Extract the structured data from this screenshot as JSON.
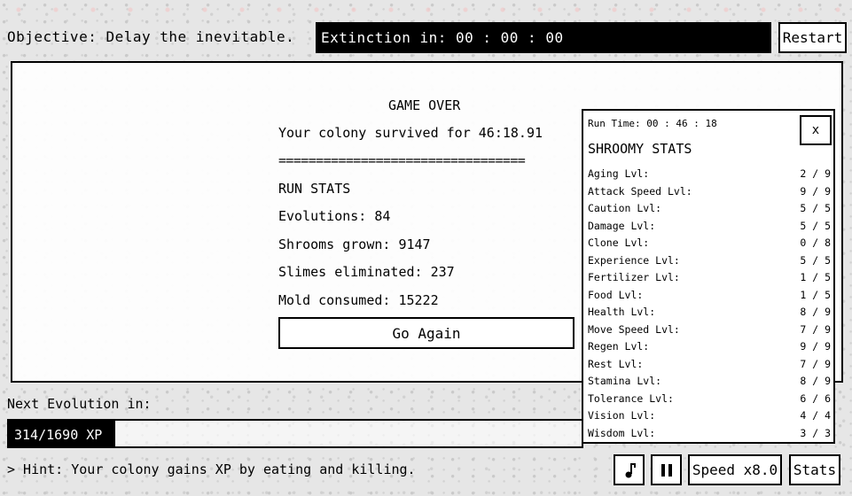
{
  "header": {
    "objective": "Objective: Delay the inevitable.",
    "extinction": "Extinction in: 00 : 00 : 00",
    "restart_label": "Restart"
  },
  "game_over": {
    "title": "GAME OVER",
    "survived": "Your colony survived for 46:18.91",
    "divider": "=================================",
    "run_stats_heading": "RUN STATS",
    "evolutions": "Evolutions: 84",
    "shrooms": "Shrooms grown: 9147",
    "slimes": "Slimes eliminated: 237",
    "mold": "Mold consumed: 15222",
    "go_again_label": "Go Again"
  },
  "stats_panel": {
    "run_time": "Run Time: 00 : 46 : 18",
    "title": "SHROOMY STATS",
    "close_label": "x",
    "rows": [
      {
        "label": "Aging Lvl:",
        "value": "2 / 9"
      },
      {
        "label": "Attack Speed Lvl:",
        "value": "9 / 9"
      },
      {
        "label": "Caution Lvl:",
        "value": "5 / 5"
      },
      {
        "label": "Damage Lvl:",
        "value": "5 / 5"
      },
      {
        "label": "Clone Lvl:",
        "value": "0 / 8"
      },
      {
        "label": "Experience Lvl:",
        "value": "5 / 5"
      },
      {
        "label": "Fertilizer Lvl:",
        "value": "1 / 5"
      },
      {
        "label": "Food Lvl:",
        "value": "1 / 5"
      },
      {
        "label": "Health Lvl:",
        "value": "8 / 9"
      },
      {
        "label": "Move Speed Lvl:",
        "value": "7 / 9"
      },
      {
        "label": "Regen Lvl:",
        "value": "9 / 9"
      },
      {
        "label": "Rest Lvl:",
        "value": "7 / 9"
      },
      {
        "label": "Stamina Lvl:",
        "value": "8 / 9"
      },
      {
        "label": "Tolerance Lvl:",
        "value": "6 / 6"
      },
      {
        "label": "Vision Lvl:",
        "value": "4 / 4"
      },
      {
        "label": "Wisdom Lvl:",
        "value": "3 / 3"
      }
    ]
  },
  "evolution": {
    "label": "Next Evolution in:",
    "xp_text": "314/1690 XP",
    "xp_current": 314,
    "xp_max": 1690
  },
  "footer": {
    "hint": "> Hint: Your colony gains XP by eating and killing.",
    "music_icon": "music-note-icon",
    "pause_icon": "pause-icon",
    "speed_label": "Speed x8.0",
    "stats_label": "Stats"
  },
  "colors": {
    "background": "#e6e6e6",
    "panel": "#ffffff",
    "ink": "#000000"
  }
}
